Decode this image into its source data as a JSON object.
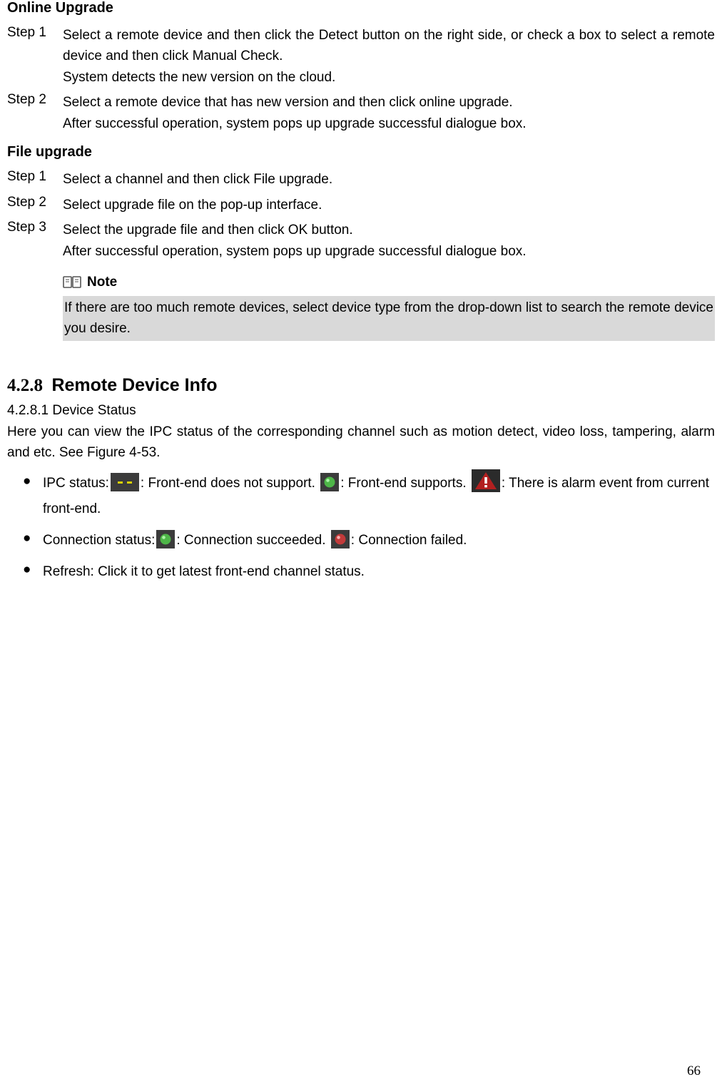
{
  "online_upgrade": {
    "heading": "Online Upgrade",
    "steps": [
      {
        "label": "Step 1",
        "lines": [
          "Select a remote device and then click the Detect button on the right side, or check a box to select a remote device and then click Manual Check.",
          "System detects the new version on the cloud."
        ]
      },
      {
        "label": "Step 2",
        "lines": [
          "Select a remote device that has new version and then click online upgrade.",
          "After successful operation, system pops up upgrade successful dialogue box."
        ]
      }
    ]
  },
  "file_upgrade": {
    "heading": "File upgrade",
    "steps": [
      {
        "label": "Step 1",
        "lines": [
          "Select a channel and then click File upgrade."
        ]
      },
      {
        "label": "Step 2",
        "lines": [
          "Select upgrade file on the pop-up interface."
        ]
      },
      {
        "label": "Step 3",
        "lines": [
          "Select the upgrade file and then click OK button.",
          "After successful operation, system pops up upgrade successful dialogue box."
        ]
      }
    ],
    "note_label": "Note",
    "note_text": "If there are too much remote devices, select device type from the drop-down list to search the remote device you desire."
  },
  "section_428": {
    "number": "4.2.8",
    "title": "Remote Device Info",
    "sub_number": "4.2.8.1 Device Status",
    "intro": "Here you can view the IPC status of the corresponding channel such as motion detect, video loss, tampering, alarm and etc. See Figure 4-53."
  },
  "bullets": {
    "ipc_prefix": "IPC status:",
    "ipc_no_support": ": Front-end does not support.  ",
    "ipc_supports": ": Front-end supports.    ",
    "ipc_alarm": ": There is alarm event from current front-end.",
    "conn_prefix": "Connection status:",
    "conn_ok": ": Connection succeeded.  ",
    "conn_fail": ": Connection failed.",
    "refresh": "Refresh: Click it to get latest front-end channel status."
  },
  "icon_names": {
    "no_support": "status-unsupported-icon",
    "supports": "status-green-dot-icon",
    "alarm": "alert-triangle-icon",
    "conn_ok": "status-green-dot-icon",
    "conn_fail": "status-red-dot-icon",
    "note": "book-open-icon"
  },
  "page_number": "66"
}
